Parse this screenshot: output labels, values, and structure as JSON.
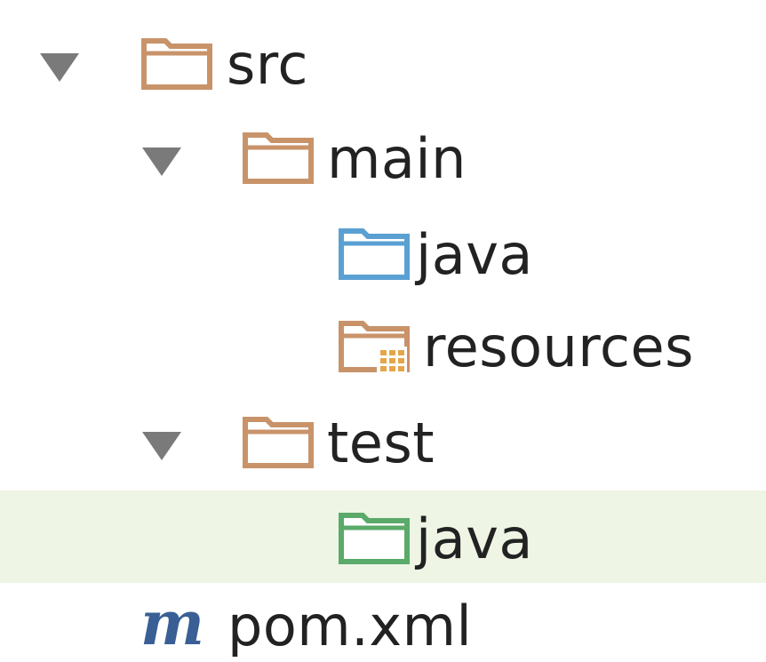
{
  "tree": {
    "src": {
      "label": "src",
      "expanded": true,
      "icon": "source-root-folder-icon"
    },
    "main": {
      "label": "main",
      "expanded": true,
      "icon": "folder-icon"
    },
    "main_java": {
      "label": "java",
      "icon": "sources-folder-icon",
      "color": "#5aa0d2"
    },
    "resources": {
      "label": "resources",
      "icon": "resources-folder-icon",
      "color": "#e5a64a"
    },
    "test": {
      "label": "test",
      "expanded": true,
      "icon": "folder-icon"
    },
    "test_java": {
      "label": "java",
      "icon": "test-sources-folder-icon",
      "color": "#5aaa6a",
      "selected": true
    },
    "pom": {
      "label": "pom.xml",
      "icon_glyph": "m",
      "icon": "maven-icon",
      "color": "#3a5f95"
    }
  },
  "colors": {
    "folder": "#c9936a",
    "arrow": "#7a7a7a",
    "selection": "#eef5e4"
  }
}
